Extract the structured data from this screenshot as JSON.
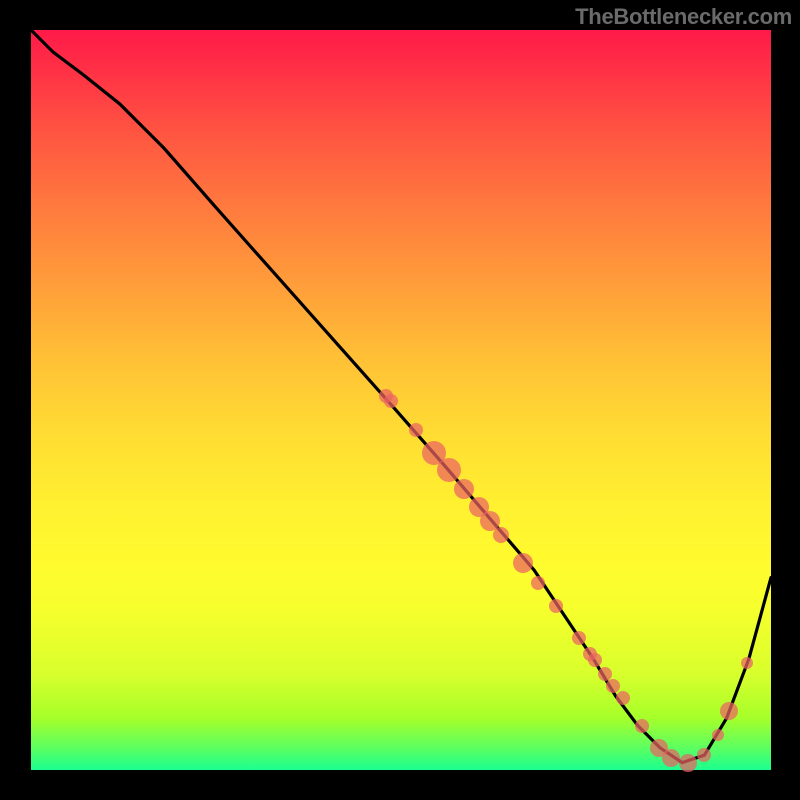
{
  "watermark": "TheBottlenecker.com",
  "colors": {
    "frame": "#000000",
    "curve": "#000000",
    "dot": "rgba(236,98,98,0.72)"
  },
  "chart_data": {
    "type": "line",
    "title": "",
    "xlabel": "",
    "ylabel": "",
    "xlim": [
      0,
      100
    ],
    "ylim": [
      0,
      100
    ],
    "series": [
      {
        "name": "bottleneck-curve",
        "x": [
          0,
          3,
          7,
          12,
          18,
          25,
          33,
          41,
          49,
          56,
          62,
          68,
          72,
          76,
          79,
          82,
          85,
          88,
          91,
          94,
          97,
          100
        ],
        "values": [
          100,
          97,
          94,
          90,
          84,
          76,
          67,
          58,
          49,
          41,
          34,
          27,
          21,
          15,
          10,
          6,
          3,
          1,
          2,
          7,
          15,
          26
        ]
      }
    ],
    "points": [
      {
        "x": 48.0,
        "y": 50.5,
        "r": 7
      },
      {
        "x": 48.6,
        "y": 49.8,
        "r": 7
      },
      {
        "x": 52.0,
        "y": 45.9,
        "r": 7
      },
      {
        "x": 54.5,
        "y": 42.9,
        "r": 12
      },
      {
        "x": 56.5,
        "y": 40.5,
        "r": 12
      },
      {
        "x": 58.5,
        "y": 38.0,
        "r": 10
      },
      {
        "x": 60.5,
        "y": 35.6,
        "r": 10
      },
      {
        "x": 62.0,
        "y": 33.7,
        "r": 10
      },
      {
        "x": 63.5,
        "y": 31.8,
        "r": 8
      },
      {
        "x": 66.5,
        "y": 28.0,
        "r": 10
      },
      {
        "x": 68.5,
        "y": 25.3,
        "r": 7
      },
      {
        "x": 71.0,
        "y": 22.1,
        "r": 7
      },
      {
        "x": 74.0,
        "y": 17.8,
        "r": 7
      },
      {
        "x": 75.5,
        "y": 15.7,
        "r": 7
      },
      {
        "x": 76.2,
        "y": 14.8,
        "r": 7
      },
      {
        "x": 77.5,
        "y": 13.0,
        "r": 7
      },
      {
        "x": 78.7,
        "y": 11.4,
        "r": 7
      },
      {
        "x": 80.0,
        "y": 9.7,
        "r": 7
      },
      {
        "x": 82.5,
        "y": 6.0,
        "r": 7
      },
      {
        "x": 84.8,
        "y": 3.0,
        "r": 9
      },
      {
        "x": 86.5,
        "y": 1.6,
        "r": 9
      },
      {
        "x": 88.8,
        "y": 1.0,
        "r": 9
      },
      {
        "x": 91.0,
        "y": 2.0,
        "r": 7
      },
      {
        "x": 92.8,
        "y": 4.7,
        "r": 6
      },
      {
        "x": 94.3,
        "y": 8.0,
        "r": 9
      },
      {
        "x": 96.8,
        "y": 14.5,
        "r": 6
      }
    ]
  }
}
